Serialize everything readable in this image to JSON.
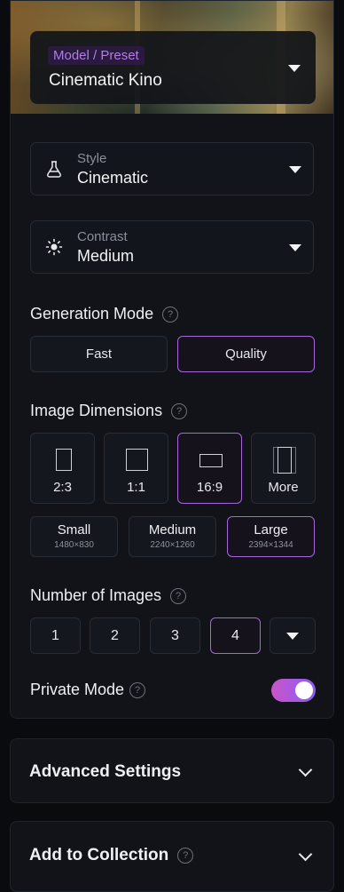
{
  "preset": {
    "tag": "Model / Preset",
    "value": "Cinematic Kino"
  },
  "style": {
    "label": "Style",
    "value": "Cinematic",
    "icon": "flask-icon"
  },
  "contrast": {
    "label": "Contrast",
    "value": "Medium",
    "icon": "sun-icon"
  },
  "generation_mode": {
    "title": "Generation Mode",
    "options": [
      "Fast",
      "Quality"
    ],
    "selected": "Quality"
  },
  "image_dimensions": {
    "title": "Image Dimensions",
    "ratios": [
      "2:3",
      "1:1",
      "16:9",
      "More"
    ],
    "selected_ratio": "16:9",
    "sizes": [
      {
        "name": "Small",
        "dims": "1480×830"
      },
      {
        "name": "Medium",
        "dims": "2240×1260"
      },
      {
        "name": "Large",
        "dims": "2394×1344"
      }
    ],
    "selected_size": "Large"
  },
  "number_of_images": {
    "title": "Number of Images",
    "options": [
      "1",
      "2",
      "3",
      "4"
    ],
    "selected": "4"
  },
  "private_mode": {
    "label": "Private Mode",
    "enabled": true
  },
  "advanced_settings": {
    "title": "Advanced Settings"
  },
  "add_to_collection": {
    "title": "Add to Collection"
  },
  "help_glyph": "?",
  "colors": {
    "accent": "#a765e0",
    "toggle_start": "#c955c9",
    "toggle_end": "#8b5cf6",
    "panel": "#111318"
  }
}
